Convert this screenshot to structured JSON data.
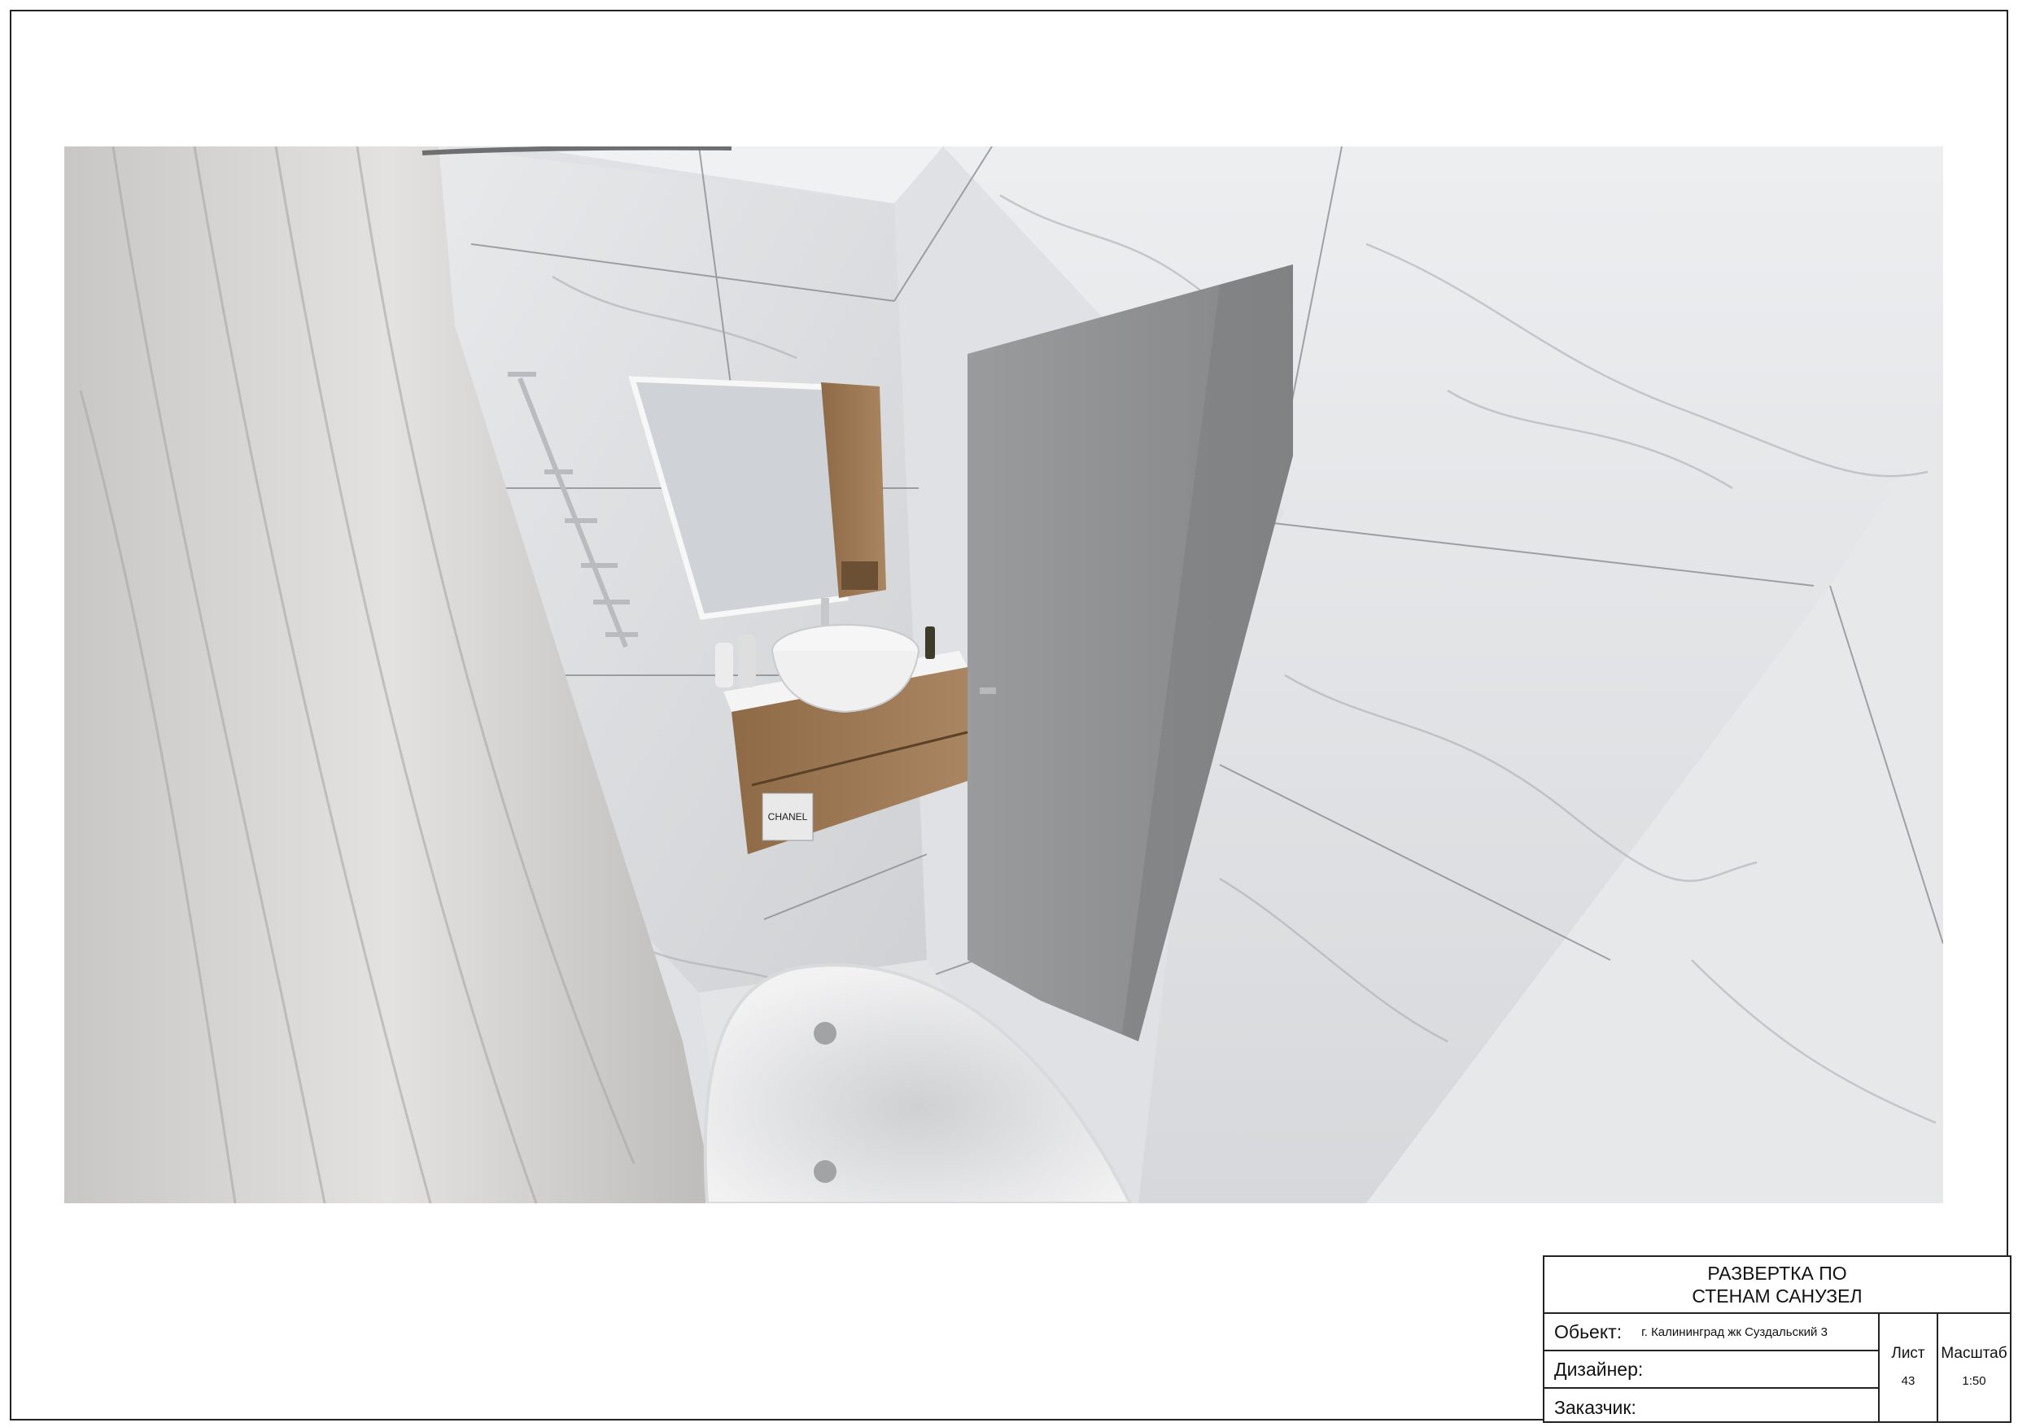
{
  "render": {
    "label": "CHANEL"
  },
  "stamp": {
    "title_line1": "РАЗВЕРТКА ПО",
    "title_line2": "СТЕНАМ САНУЗЕЛ",
    "object_label": "Обьект:",
    "object_value": "г. Калининград жк Суздальский 3",
    "designer_label": "Дизайнер:",
    "designer_value": "",
    "client_label": "Заказчик:",
    "client_value": "",
    "sheet_label": "Лист",
    "sheet_value": "43",
    "scale_label": "Масштаб",
    "scale_value": "1:50"
  },
  "colors": {
    "frame": "#222222",
    "marble": "#e4e6e9",
    "vein": "#9a9ca0",
    "door": "#8f9092",
    "wood": "#9a7551",
    "curtain": "#d4d3d1"
  }
}
